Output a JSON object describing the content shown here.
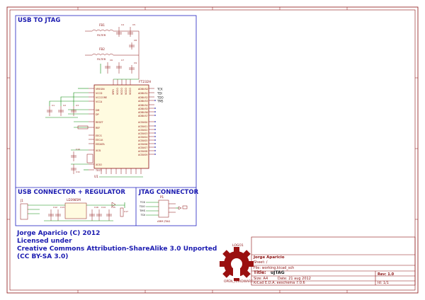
{
  "sections": {
    "usb_to_jtag": "USB TO JTAG",
    "usb_connector": "USB CONNECTOR + REGULATOR",
    "jtag_connector": "JTAG CONNECTOR"
  },
  "credits": {
    "line1": "Jorge Aparicio (C) 2012",
    "line2": "Licensed under",
    "line3": "Creative Commons Attribution-ShareAlike 3.0 Unported",
    "line4": "(CC BY-SA 3.0)"
  },
  "logo": {
    "ref": "LOGO1",
    "value": "OPEN_HARDWARE"
  },
  "title_block": {
    "company": "Jorge Aparicio",
    "sheet_label": "Sheet: /",
    "file_label": "File: working.kicad_sch",
    "title_label": "Title:",
    "title_value": "uJTAG",
    "size_label": "Size: A4",
    "date_label": "Date: 21 aug 2012",
    "rev_label": "Rev: 1.0",
    "tool_label": "KiCad E.D.A.  eeschema 7.0.6",
    "id_label": "Id: 1/1"
  },
  "schematic": {
    "ic_ref": "FT232H",
    "ic_unit": "U1",
    "ferrite_1": "FB1",
    "ferrite_2": "FB2",
    "filter_label": "FILTER",
    "regulator": "LD3985M",
    "ic_left_pins": [
      "VREGIN",
      "VCCD",
      "VCCCORE",
      "VCCA",
      "DM",
      "DP",
      "RESET",
      "REF",
      "EECS",
      "EECLK",
      "EEDATA",
      "XCSI",
      "XCSO",
      "TEST"
    ],
    "ic_right_pins_ad": [
      "ADBUS0",
      "ADBUS1",
      "ADBUS2",
      "ADBUS3",
      "ADBUS4",
      "ADBUS5",
      "ADBUS6",
      "ADBUS7"
    ],
    "ic_right_pins_ac": [
      "ACBUS0",
      "ACBUS1",
      "ACBUS2",
      "ACBUS3",
      "ACBUS4",
      "ACBUS5",
      "ACBUS6",
      "ACBUS7",
      "ACBUS8",
      "ACBUS9"
    ],
    "ic_top_pins": [
      "VPHY",
      "VCCIO",
      "VCCIO",
      "VCCIO",
      "VCCIO"
    ],
    "jtag_nets": [
      "TCK",
      "TDI",
      "TDO",
      "TMS"
    ],
    "jtag_conn_nets": [
      "TCK",
      "TDO",
      "TMS",
      "TDI"
    ],
    "cap_refs": [
      "C1",
      "C2",
      "C3",
      "C4",
      "C5",
      "C6",
      "C7",
      "C8",
      "C9",
      "C10",
      "C11",
      "C12",
      "C13",
      "C14",
      "C15",
      "C16",
      "C17"
    ],
    "usb_conn": "J1",
    "jtag_conn": "P1",
    "reg_pins": [
      "VIN",
      "EN",
      "GND",
      "BYP",
      "VOUT"
    ],
    "led_label": "D1",
    "resistor_labels": [
      "R1",
      "R2",
      "R3"
    ],
    "vcc_label": "3V3",
    "gnd_label": "GND",
    "jtag_hdr_label": "ARM JTAG"
  },
  "colors": {
    "border": "#8a1010",
    "wire": "#0a8a0a",
    "component": "#8a1010",
    "section_text": "#1a1ab0",
    "section_line": "#2020c0"
  }
}
